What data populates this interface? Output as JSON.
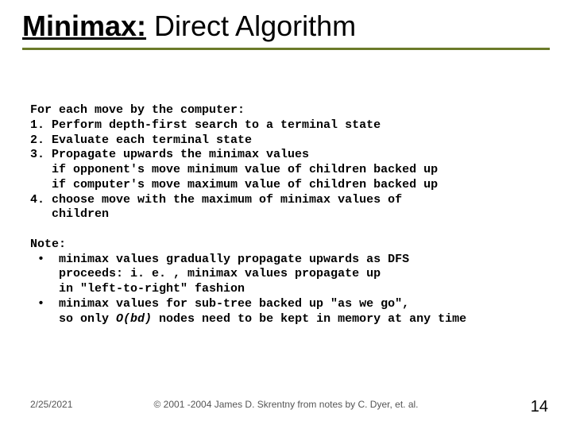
{
  "title": {
    "bold_underlined": "Minimax:",
    "rest": " Direct Algorithm"
  },
  "body_html": "For each move by the computer:\n1. Perform depth-first search to a terminal state\n2. Evaluate each terminal state\n3. Propagate upwards the minimax values\n   if opponent's move minimum value of children backed up\n   if computer's move maximum value of children backed up\n4. choose move with the maximum of minimax values of\n   children\n\nNote:\n •  minimax values gradually propagate upwards as DFS\n    proceeds: i. e. , minimax values propagate up\n    in \"left-to-right\" fashion\n •  minimax values for sub-tree backed up \"as we go\",\n    so only <em>O(bd)</em> nodes need to be kept in memory at any time",
  "footer": {
    "date": "2/25/2021",
    "copyright": "© 2001 -2004 James D. Skrentny from notes by C. Dyer, et. al.",
    "page": "14"
  }
}
